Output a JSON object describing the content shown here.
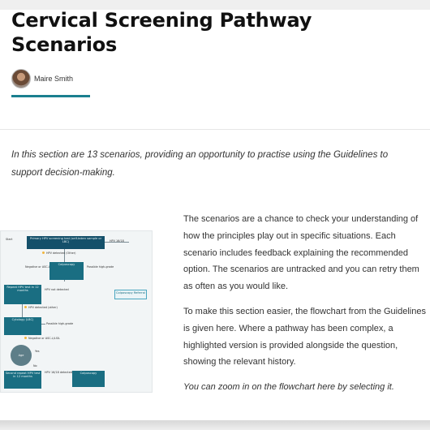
{
  "article": {
    "title": "Cervical Screening Pathway Scenarios",
    "author": "Maire Smith",
    "intro": "In this section are 13 scenarios, providing an opportunity to practise using the Guidelines to support decision-making.",
    "paragraphs": [
      "The scenarios are a chance to check your understanding of how the principles play out in specific situations. Each scenario includes feedback explaining the recommended option. The scenarios are untracked and you can retry them as often as you would like.",
      "To make this section easier, the flowchart from the Guidelines is given here. Where a pathway has been complex, a highlighted version is provided alongside the question, showing the relevant history."
    ],
    "zoom_note": "You can zoom in on the flowchart here by selecting it."
  },
  "flowchart": {
    "boxes": {
      "primary": "Primary HPV screening test (self-taken sample or LBC)",
      "colposcopy": "Colposcopy",
      "repeat12": "Repeat HPV test in 12 months",
      "hpv_detected": "HPV detected (other)",
      "cytology": "Cytology (LBC)",
      "colposcopy_referral": "Colposcopy Referral",
      "colposcopy2": "Colposcopy",
      "second_repeat": "Second repeat HPV test in 12 months",
      "age_circle": "Age",
      "start": "Start",
      "hpv1618": "HPV 16/18 detected"
    },
    "labels": {
      "not_detected": "HPV not detected",
      "hpv_other": "HPV detected (Other)",
      "hpv1618": "HPV 16/18",
      "negative": "Negative or ASC-L/LSIL",
      "possible_high": "Possible high-grade",
      "yes": "Yes",
      "no": "No"
    }
  }
}
